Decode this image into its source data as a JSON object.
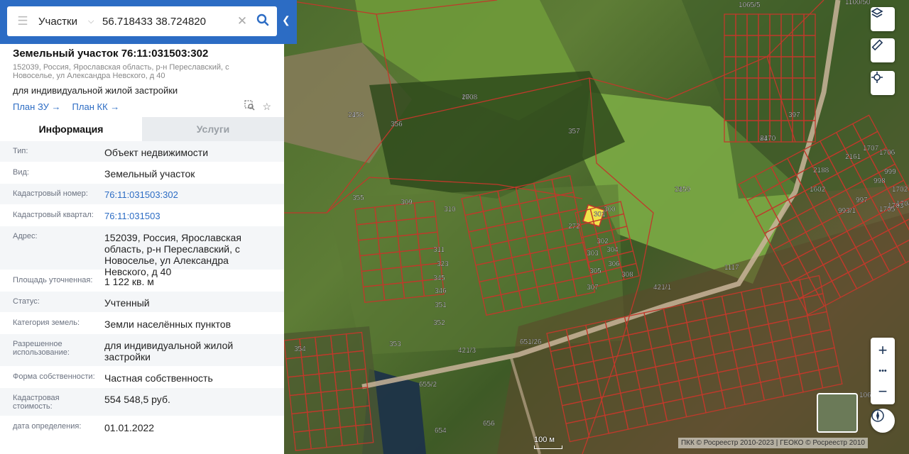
{
  "search": {
    "layer_select": "Участки",
    "query": "56.718433 38.724820"
  },
  "panel": {
    "title": "Земельный участок 76:11:031503:302",
    "address_short": "152039, Россия, Ярославская область, р-н Переславский, с Новоселье, ул Александра Невского, д 40",
    "purpose": "для индивидуальной жилой застройки",
    "links": [
      "План ЗУ",
      "План КК"
    ],
    "tabs": [
      "Информация",
      "Услуги"
    ],
    "rows": [
      {
        "label": "Тип:",
        "value": "Объект недвижимости"
      },
      {
        "label": "Вид:",
        "value": "Земельный участок"
      },
      {
        "label": "Кадастровый номер:",
        "value": "76:11:031503:302"
      },
      {
        "label": "Кадастровый квартал:",
        "value": "76:11:031503"
      },
      {
        "label": "Адрес:",
        "value": "152039, Россия, Ярославская область, р-н Переславский, с Новоселье, ул Александра Невского, д 40"
      },
      {
        "label": "Площадь уточненная:",
        "value": "1 122 кв. м"
      },
      {
        "label": "Статус:",
        "value": "Учтенный"
      },
      {
        "label": "Категория земель:",
        "value": "Земли населённых пунктов"
      },
      {
        "label": "Разрешенное использование:",
        "value": "для индивидуальной жилой застройки"
      },
      {
        "label": "Форма собственности:",
        "value": "Частная собственность"
      },
      {
        "label": "Кадастровая стоимость:",
        "value": "554 548,5 руб."
      },
      {
        "label": "дата определения:",
        "value": "01.01.2022"
      }
    ]
  },
  "map": {
    "labels": [
      "20",
      "24",
      "28",
      "84",
      "272",
      "300",
      "301",
      "302",
      "303",
      "304",
      "305",
      "306",
      "307",
      "308",
      "309",
      "310",
      "311",
      "323",
      "345",
      "346",
      "351",
      "352",
      "353",
      "354",
      "355",
      "356",
      "357",
      "397",
      "421/1",
      "421/3",
      "651/26",
      "655/2",
      "654",
      "656",
      "1065/5",
      "1100/50",
      "1117",
      "1065/2",
      "1602",
      "2188",
      "2161",
      "993/1",
      "997",
      "998",
      "999",
      "1702",
      "1703",
      "1704",
      "1705",
      "1706",
      "1707",
      "1708",
      "2158",
      "2159",
      "2170"
    ],
    "zoom_in": "+",
    "zoom_out": "−",
    "more": "•••",
    "scale": "100 м",
    "copyright": "ПКК © Росреестр 2010-2023 | ГЕОКО © Росреестр 2010"
  },
  "colors": {
    "accent": "#2c6cc4",
    "parcel_border": "#c0392b",
    "selected_parcel": "#f1e44a"
  }
}
